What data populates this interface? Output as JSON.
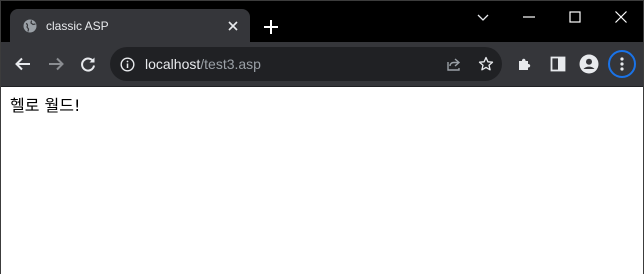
{
  "tab": {
    "title": "classic ASP"
  },
  "address_bar": {
    "host": "localhost",
    "path": "/test3.asp"
  },
  "page": {
    "body_text": "헬로 월드!"
  },
  "colors": {
    "tab_strip": "#000000",
    "toolbar": "#35363a",
    "omnibox": "#202124",
    "focus_ring": "#1a73e8"
  },
  "icons": [
    "globe-icon",
    "close-icon",
    "plus-icon",
    "chevron-down-icon",
    "minimize-icon",
    "maximize-icon",
    "close-window-icon",
    "back-arrow-icon",
    "forward-arrow-icon",
    "reload-icon",
    "info-icon",
    "share-icon",
    "star-icon",
    "puzzle-icon",
    "side-panel-icon",
    "profile-icon",
    "more-vert-icon"
  ]
}
